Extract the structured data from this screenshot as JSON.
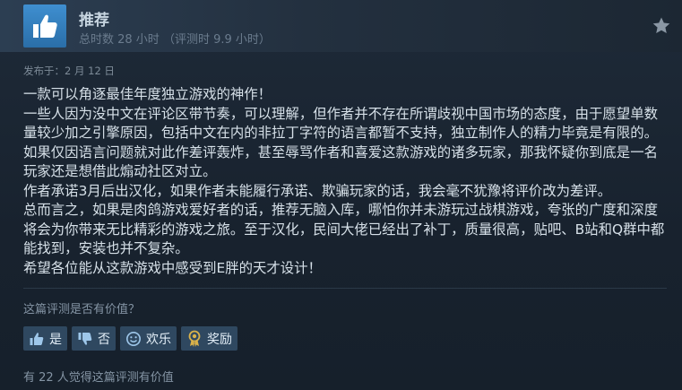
{
  "header": {
    "verdict": "推荐",
    "hours": "总时数 28 小时 （评测时 9.9 小时）",
    "verdict_icon": "thumbs-up-icon",
    "award_icon": "award-star-icon"
  },
  "posted": "发布于：2 月 12 日",
  "review": {
    "paragraphs": [
      "一款可以角逐最佳年度独立游戏的神作！",
      "一些人因为没中文在评论区带节奏，可以理解，但作者并不存在所谓歧视中国市场的态度，由于愿望单数量较少加之引擎原因，包括中文在内的非拉丁字符的语言都暂不支持，独立制作人的精力毕竟是有限的。如果仅因语言问题就对此作差评轰炸，甚至辱骂作者和喜爱这款游戏的诸多玩家，那我怀疑你到底是一名玩家还是想借此煽动社区对立。",
      "作者承诺3月后出汉化，如果作者未能履行承诺、欺骗玩家的话，我会毫不犹豫将评价改为差评。",
      "总而言之，如果是肉鸽游戏爱好者的话，推荐无脑入库，哪怕你并未游玩过战棋游戏，夸张的广度和深度将会为你带来无比精彩的游戏之旅。至于汉化，民间大佬已经出了补丁，质量很高，贴吧、B站和Q群中都能找到，安装也并不复杂。",
      "希望各位能从这款游戏中感受到E胖的天才设计！"
    ]
  },
  "helpful_question": "这篇评测是否有价值？",
  "buttons": {
    "yes": "是",
    "no": "否",
    "funny": "欢乐",
    "award": "奖励"
  },
  "helpful_count": "有 22 人觉得这篇评测有价值",
  "colors": {
    "background": "#1b2838",
    "thumb_box": "#3f8fd0",
    "button": "#2f4860",
    "award_gold": "#d9b24a"
  }
}
